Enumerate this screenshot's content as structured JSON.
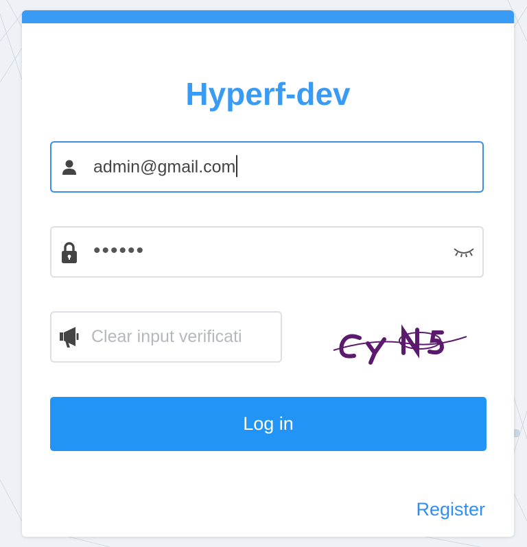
{
  "colors": {
    "accent": "#3a9bf5",
    "button": "#2294f5",
    "link": "#2e8ff0",
    "captcha": "#5b1a6e"
  },
  "app": {
    "title": "Hyperf-dev"
  },
  "form": {
    "username": {
      "value": "admin@gmail.com",
      "icon": "user-icon"
    },
    "password": {
      "masked_value": "••••••",
      "icon": "lock-icon",
      "toggle_icon": "eye-closed-icon"
    },
    "captcha": {
      "placeholder": "Clear input verificati",
      "icon": "megaphone-icon",
      "image_text": "CYN5"
    },
    "login_label": "Log in",
    "register_label": "Register"
  }
}
